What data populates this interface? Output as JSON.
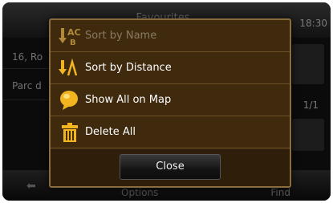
{
  "background": {
    "header_title": "Favourites",
    "time": "18:30",
    "rows": [
      "16, Ro",
      "Parc d"
    ],
    "pager": "1/1",
    "footer_options": "Options",
    "footer_find": "Find"
  },
  "popup": {
    "items": [
      {
        "label": "Sort by Name",
        "icon": "sort-alpha-icon",
        "enabled": false
      },
      {
        "label": "Sort by Distance",
        "icon": "sort-distance-icon",
        "enabled": true
      },
      {
        "label": "Show All on Map",
        "icon": "map-pin-icon",
        "enabled": true
      },
      {
        "label": "Delete All",
        "icon": "trash-icon",
        "enabled": true
      }
    ],
    "close_label": "Close"
  },
  "colors": {
    "popup_bg": "#3f2a0e",
    "popup_border": "#8a6c3d",
    "icon_accent": "#f2b520"
  }
}
